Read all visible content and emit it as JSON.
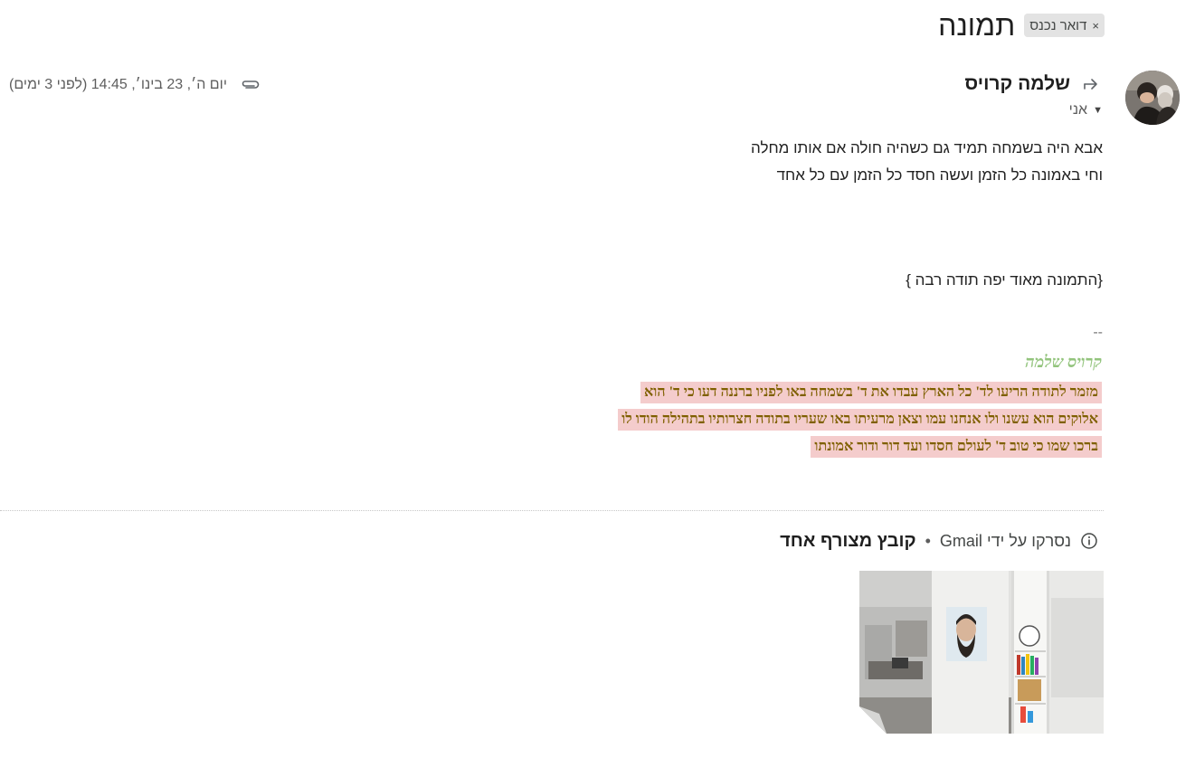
{
  "subject": {
    "title": "תמונה",
    "label": "דואר נכנס",
    "label_remove": "×"
  },
  "message": {
    "sender_name": "שלמה קרויס",
    "to_label": "אני",
    "date": "יום ה׳, 23 בינו׳, 14:45 (לפני 3 ימים)",
    "icons": {
      "reply": "reply-icon",
      "attachment": "paperclip-icon",
      "dropdown": "caret-down-icon"
    },
    "body": {
      "line1": "אבא היה בשמחה תמיד גם כשהיה חולה אם אותו מחלה",
      "line2": "וחי באמונה כל הזמן ועשה חסד כל הזמן עם כל אחד",
      "line3": "{התמונה מאוד יפה תודה רבה }",
      "separator": "--"
    },
    "signature": {
      "name": "קרויס שלמה",
      "line1": "מזמר לתודה הריעו לד' כל הארץ עבדו את ד' בשמחה באו לפניו ברננה דעו כי ד' הוא",
      "line2": "אלוקים הוא עשנו ולו אנחנו עמו וצאן מרעיתו באו שעריו בתודה חצרותיו בתהילה הודו לו",
      "line3": "ברכו שמו כי טוב ד' לעולם חסדו ועד דור ודור אמונתו",
      "name_color": "#93c47d",
      "text_color": "#7f6000",
      "highlight_color": "#f4cccc"
    }
  },
  "attachments": {
    "count_label": "קובץ מצורף אחד",
    "separator": "•",
    "scan_text": "נסרקו על ידי Gmail",
    "info_icon": "info-icon"
  }
}
